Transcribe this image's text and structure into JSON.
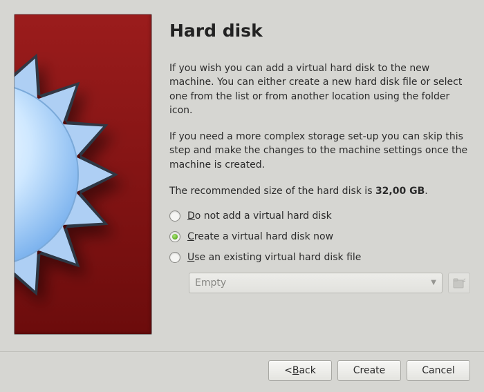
{
  "title": "Hard disk",
  "paragraphs": {
    "p1": "If you wish you can add a virtual hard disk to the new machine. You can either create a new hard disk file or select one from the list or from another location using the folder icon.",
    "p2": "If you need a more complex storage set-up you can skip this step and make the changes to the machine settings once the machine is created.",
    "p3_prefix": "The recommended size of the hard disk is ",
    "p3_value": "32,00 GB",
    "p3_suffix": "."
  },
  "options": {
    "none": {
      "letter": "D",
      "rest": "o not add a virtual hard disk"
    },
    "create": {
      "letter": "C",
      "rest": "reate a virtual hard disk now"
    },
    "existing": {
      "letter": "U",
      "rest": "se an existing virtual hard disk file"
    }
  },
  "selected_option": "create",
  "file_combo": {
    "value": "Empty",
    "enabled": false
  },
  "buttons": {
    "back": {
      "lt": "< ",
      "letter": "B",
      "rest": "ack"
    },
    "create": "Create",
    "cancel": "Cancel"
  }
}
